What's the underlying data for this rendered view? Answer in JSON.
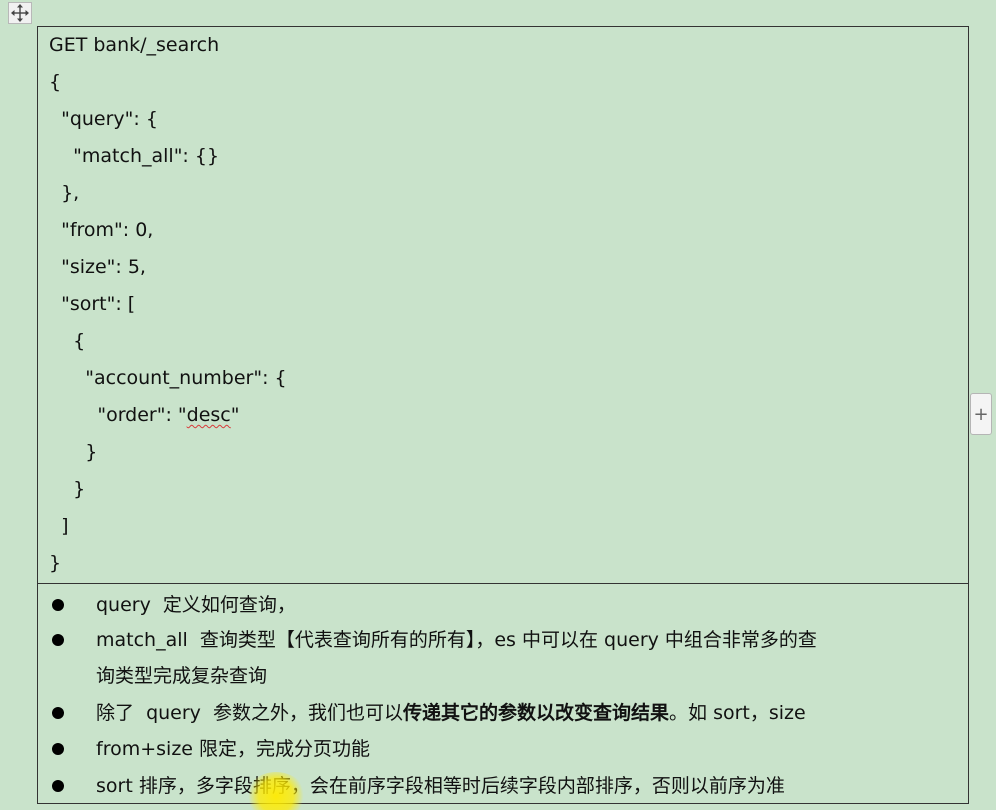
{
  "icons": {
    "move_handle": "move-arrows-icon",
    "add_column": "plus-icon"
  },
  "side_button": {
    "label": "+"
  },
  "code": {
    "lines": [
      "GET bank/_search",
      "{",
      "  \"query\": {",
      "    \"match_all\": {}",
      "  },",
      "  \"from\": 0,",
      "  \"size\": 5,",
      "  \"sort\": [",
      "    {",
      "      \"account_number\": {",
      "        \"order\": \"desc\"",
      "      }",
      "    }",
      "  ]",
      "}"
    ],
    "desc_value": "desc",
    "order_prefix": "\"order\": \"",
    "order_suffix": "\""
  },
  "notes": {
    "n1": "query  定义如何查询，",
    "n2": "match_all  查询类型【代表查询所有的所有】，es 中可以在 query 中组合非常多的查",
    "n2_cont": "询类型完成复杂查询",
    "n3_a": "除了  query  参数之外，我们也可以",
    "n3_bold": "传递其它的参数以改变查询结果",
    "n3_b": "。如 sort，size",
    "n4": "from+size 限定，完成分页功能",
    "n5": "sort 排序，多字段排序，会在前序字段相等时后续字段内部排序，否则以前序为准"
  },
  "colors": {
    "background": "#c9e3cb",
    "border": "#333333",
    "highlight": "#ffeb00",
    "spellcheck": "#d83a3a"
  }
}
